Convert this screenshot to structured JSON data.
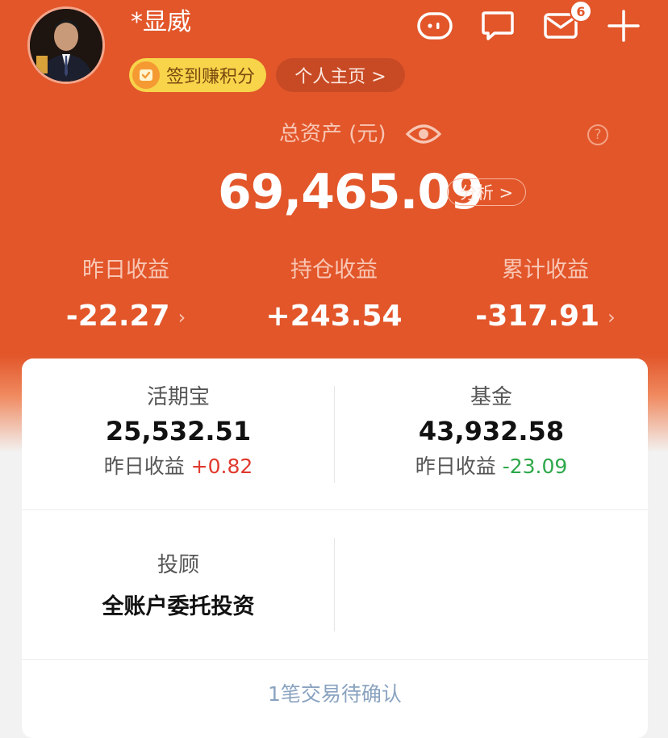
{
  "profile": {
    "username": "*显威",
    "checkin_label": "签到赚积分",
    "homepage_label": "个人主页 >"
  },
  "header_icons": {
    "mail_badge": "6",
    "icons": [
      "pig-icon",
      "chat-icon",
      "mail-icon",
      "plus-icon"
    ]
  },
  "assets": {
    "total_label": "总资产 (元)",
    "total_amount": "69,465.09",
    "analyze_label": "分析 >",
    "help_symbol": "?"
  },
  "stats": [
    {
      "label": "昨日收益",
      "value": "-22.27",
      "has_arrow": true
    },
    {
      "label": "持仓收益",
      "value": "+243.54",
      "has_arrow": false
    },
    {
      "label": "累计收益",
      "value": "-317.91",
      "has_arrow": true
    }
  ],
  "products": {
    "huoqibao": {
      "title": "活期宝",
      "amount": "25,532.51",
      "sub_label": "昨日收益",
      "sub_value": "+0.82"
    },
    "fund": {
      "title": "基金",
      "amount": "43,932.58",
      "sub_label": "昨日收益",
      "sub_value": "-23.09"
    },
    "advisor": {
      "title": "投顾",
      "desc": "全账户委托投资"
    }
  },
  "pending": "1笔交易待确认",
  "colors": {
    "brand_orange": "#e2562a",
    "gain_red": "#e03a2e",
    "loss_green": "#2ea84a",
    "pending_blue": "#8aa3c0"
  }
}
